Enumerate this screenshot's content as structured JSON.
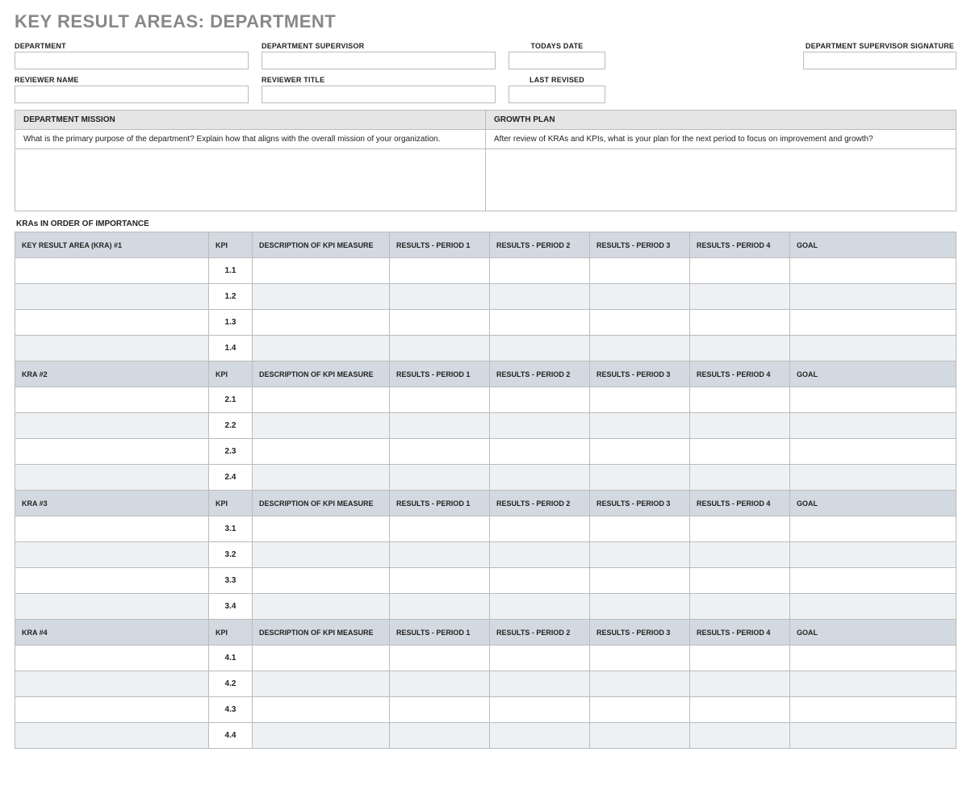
{
  "title": "KEY RESULT AREAS: DEPARTMENT",
  "info": {
    "row1": {
      "department_label": "DEPARTMENT",
      "supervisor_label": "DEPARTMENT SUPERVISOR",
      "todays_date_label": "TODAYS DATE",
      "signature_label": "DEPARTMENT SUPERVISOR SIGNATURE",
      "department_value": "",
      "supervisor_value": "",
      "todays_date_value": "",
      "signature_value": ""
    },
    "row2": {
      "reviewer_name_label": "REVIEWER NAME",
      "reviewer_title_label": "REVIEWER TITLE",
      "last_revised_label": "LAST REVISED",
      "reviewer_name_value": "",
      "reviewer_title_value": "",
      "last_revised_value": ""
    }
  },
  "mission": {
    "heading": "DEPARTMENT MISSION",
    "prompt": "What is the primary purpose of the department?  Explain how that aligns with the overall mission of your organization.",
    "body": ""
  },
  "growth": {
    "heading": "GROWTH PLAN",
    "prompt": "After review of KRAs and KPIs, what is your plan for the next period to focus on improvement and growth?",
    "body": ""
  },
  "kra_section_label": "KRAs IN ORDER OF IMPORTANCE",
  "kra_headers_common": {
    "kpi": "KPI",
    "desc": "DESCRIPTION OF KPI MEASURE",
    "p1": "RESULTS - PERIOD 1",
    "p2": "RESULTS - PERIOD 2",
    "p3": "RESULTS - PERIOD 3",
    "p4": "RESULTS - PERIOD 4",
    "goal": "GOAL"
  },
  "kras": [
    {
      "header": "KEY RESULT AREA (KRA) #1",
      "rows": [
        {
          "kpi": "1.1",
          "desc": "",
          "p1": "",
          "p2": "",
          "p3": "",
          "p4": "",
          "goal": ""
        },
        {
          "kpi": "1.2",
          "desc": "",
          "p1": "",
          "p2": "",
          "p3": "",
          "p4": "",
          "goal": ""
        },
        {
          "kpi": "1.3",
          "desc": "",
          "p1": "",
          "p2": "",
          "p3": "",
          "p4": "",
          "goal": ""
        },
        {
          "kpi": "1.4",
          "desc": "",
          "p1": "",
          "p2": "",
          "p3": "",
          "p4": "",
          "goal": ""
        }
      ]
    },
    {
      "header": "KRA #2",
      "rows": [
        {
          "kpi": "2.1",
          "desc": "",
          "p1": "",
          "p2": "",
          "p3": "",
          "p4": "",
          "goal": ""
        },
        {
          "kpi": "2.2",
          "desc": "",
          "p1": "",
          "p2": "",
          "p3": "",
          "p4": "",
          "goal": ""
        },
        {
          "kpi": "2.3",
          "desc": "",
          "p1": "",
          "p2": "",
          "p3": "",
          "p4": "",
          "goal": ""
        },
        {
          "kpi": "2.4",
          "desc": "",
          "p1": "",
          "p2": "",
          "p3": "",
          "p4": "",
          "goal": ""
        }
      ]
    },
    {
      "header": "KRA #3",
      "rows": [
        {
          "kpi": "3.1",
          "desc": "",
          "p1": "",
          "p2": "",
          "p3": "",
          "p4": "",
          "goal": ""
        },
        {
          "kpi": "3.2",
          "desc": "",
          "p1": "",
          "p2": "",
          "p3": "",
          "p4": "",
          "goal": ""
        },
        {
          "kpi": "3.3",
          "desc": "",
          "p1": "",
          "p2": "",
          "p3": "",
          "p4": "",
          "goal": ""
        },
        {
          "kpi": "3.4",
          "desc": "",
          "p1": "",
          "p2": "",
          "p3": "",
          "p4": "",
          "goal": ""
        }
      ]
    },
    {
      "header": "KRA #4",
      "rows": [
        {
          "kpi": "4.1",
          "desc": "",
          "p1": "",
          "p2": "",
          "p3": "",
          "p4": "",
          "goal": ""
        },
        {
          "kpi": "4.2",
          "desc": "",
          "p1": "",
          "p2": "",
          "p3": "",
          "p4": "",
          "goal": ""
        },
        {
          "kpi": "4.3",
          "desc": "",
          "p1": "",
          "p2": "",
          "p3": "",
          "p4": "",
          "goal": ""
        },
        {
          "kpi": "4.4",
          "desc": "",
          "p1": "",
          "p2": "",
          "p3": "",
          "p4": "",
          "goal": ""
        }
      ]
    }
  ]
}
